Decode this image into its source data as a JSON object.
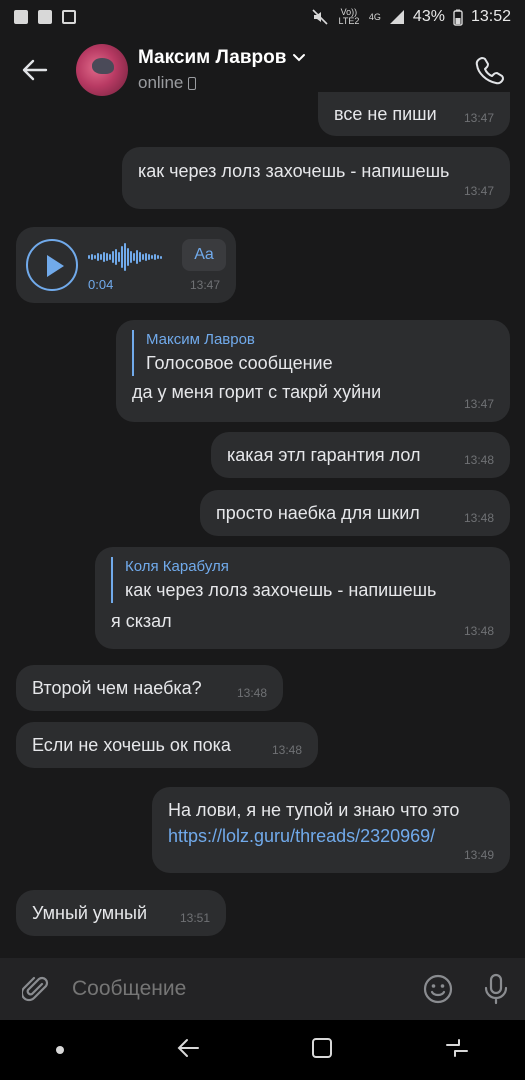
{
  "status_bar": {
    "lte_label": "Vo)) LTE2",
    "network": "4G",
    "battery": "43%",
    "time": "13:52"
  },
  "header": {
    "name": "Максим Лавров",
    "status": "online"
  },
  "messages": [
    {
      "side": "out",
      "text": "все не пиши",
      "time": "13:47"
    },
    {
      "side": "out",
      "text": "как через лолз захочешь - напишешь",
      "time": "13:47"
    },
    {
      "side": "in",
      "type": "voice",
      "duration": "0:04",
      "transcribe_label": "Aa",
      "time": "13:47"
    },
    {
      "side": "out",
      "reply_name": "Максим Лавров",
      "reply_text": "Голосовое сообщение",
      "text": "да у меня горит с такрй хуйни",
      "time": "13:47"
    },
    {
      "side": "out",
      "text": "какая этл гарантия лол",
      "time": "13:48"
    },
    {
      "side": "out",
      "text": "просто наебка для шкил",
      "time": "13:48"
    },
    {
      "side": "out",
      "reply_name": "Коля Карабуля",
      "reply_text": "как через лолз захочешь - напишешь",
      "text": "я скзал",
      "time": "13:48"
    },
    {
      "side": "in",
      "text": "Второй чем наебка?",
      "time": "13:48"
    },
    {
      "side": "in",
      "text": "Если не хочешь ок пока",
      "time": "13:48"
    },
    {
      "side": "out",
      "text": "На лови, я не тупой и знаю что это",
      "link": "https://lolz.guru/threads/2320969/",
      "time": "13:49"
    },
    {
      "side": "in",
      "text": "Умный умный",
      "time": "13:51"
    }
  ],
  "composer": {
    "placeholder": "Сообщение"
  },
  "colors": {
    "background": "#19191a",
    "bubble": "#2c2d2f",
    "accent": "#71aaeb"
  },
  "icons": [
    "back-arrow-icon",
    "chevron-down-icon",
    "phone-icon",
    "attach-icon",
    "emoji-icon",
    "mic-icon",
    "recent-apps-icon",
    "home-icon",
    "back-nav-icon"
  ]
}
